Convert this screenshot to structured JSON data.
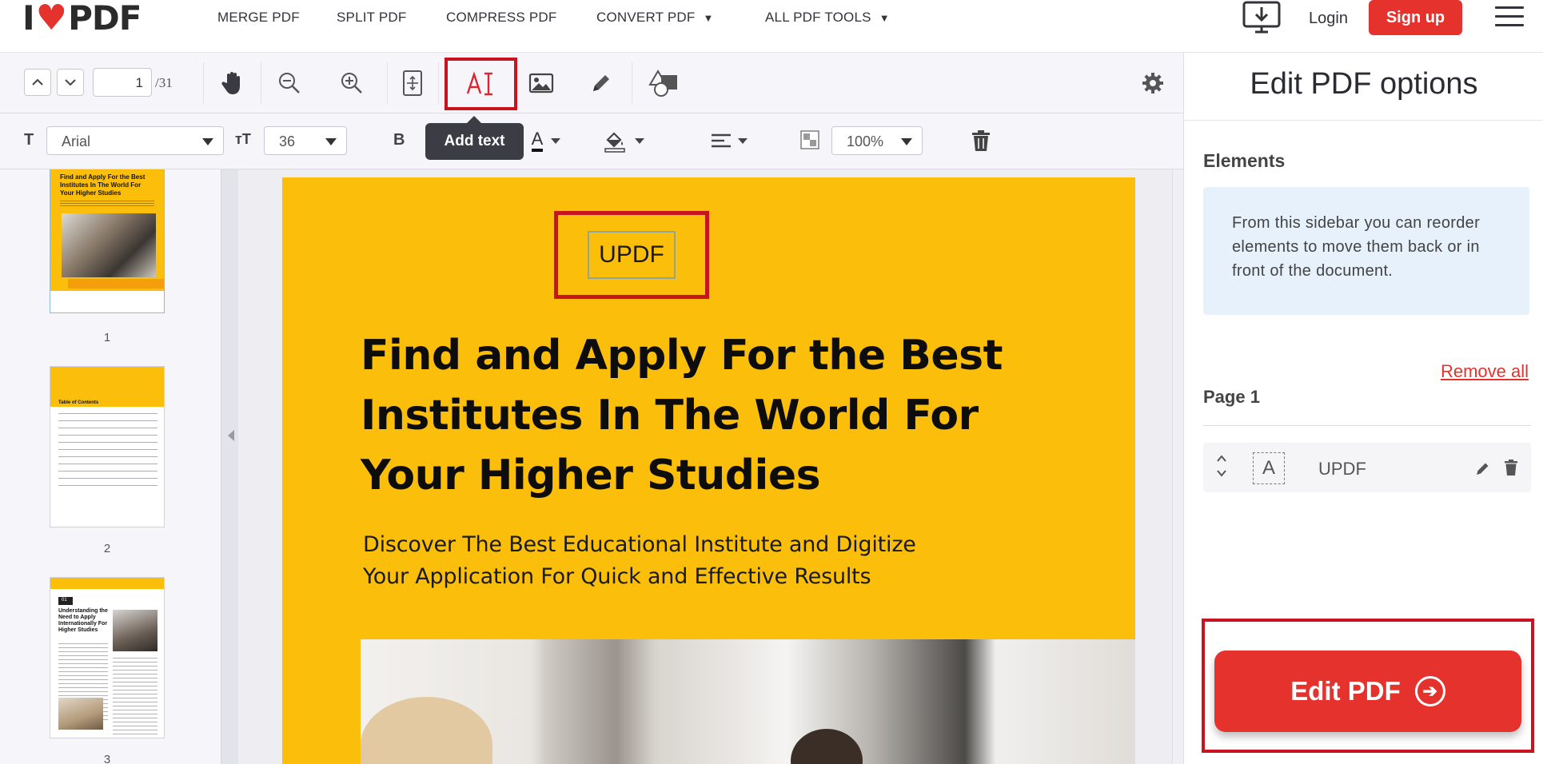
{
  "brand": {
    "logo_left": "I",
    "logo_heart": "♥",
    "logo_right": "PDF"
  },
  "nav": {
    "links": [
      "MERGE PDF",
      "SPLIT PDF",
      "COMPRESS PDF",
      "CONVERT PDF",
      "ALL PDF TOOLS"
    ],
    "login": "Login",
    "signup": "Sign up"
  },
  "toolbar": {
    "page_current": "1",
    "page_total": "/31",
    "tooltip": "Add text",
    "font_icon": "T",
    "font_family": "Arial",
    "size_icon": "ᴛT",
    "font_size": "36",
    "bold": "B",
    "color_letter": "A",
    "opacity": "100%"
  },
  "thumbnails": {
    "numbers": [
      "1",
      "2",
      "3"
    ],
    "t1_title": "Find and Apply For the Best Institutes In The World For Your Higher Studies",
    "t2_heading": "Table of Contents",
    "t3_num": "01",
    "t3_heading": "Understanding the Need to Apply Internationally For Higher Studies"
  },
  "document": {
    "added_text": "UPDF",
    "title_lines": [
      "Find and Apply For the Best",
      "Institutes In The World For",
      "Your Higher Studies"
    ],
    "subtitle_lines": [
      "Discover The Best Educational Institute and Digitize",
      "Your Application For Quick and Effective Results"
    ]
  },
  "sidebar": {
    "title": "Edit PDF options",
    "elements_heading": "Elements",
    "info": "From this sidebar you can reorder elements to move them back or in front of the document.",
    "remove_all": "Remove all",
    "page_heading": "Page 1",
    "element_icon_letter": "A",
    "element_label": "UPDF",
    "edit_button": "Edit PDF",
    "edit_button_icon": "➔"
  },
  "colors": {
    "brand_red": "#e5322d",
    "highlight_red": "#c7141e",
    "doc_yellow": "#fbbf0b",
    "info_blue": "#e6f1fb"
  }
}
